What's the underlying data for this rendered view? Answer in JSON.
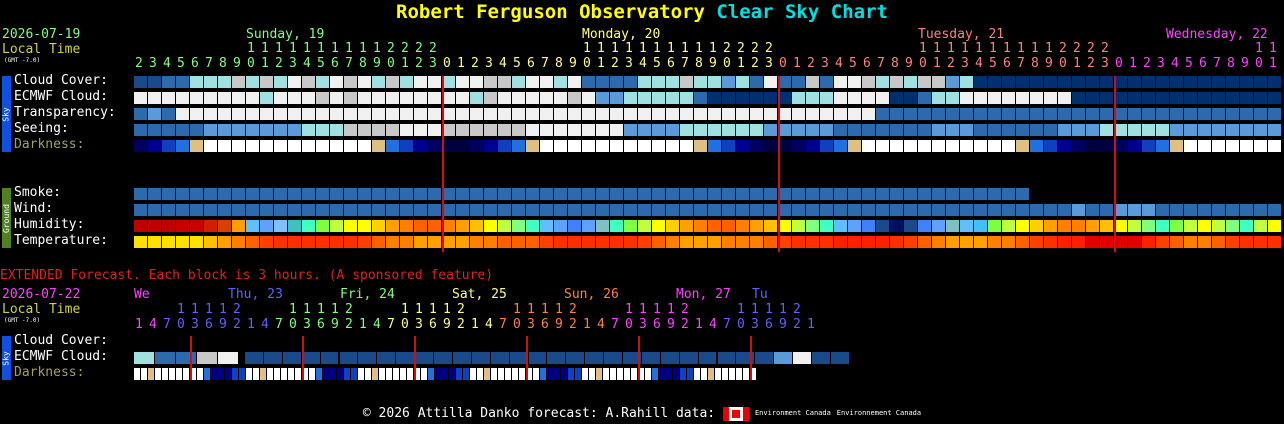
{
  "title": {
    "name": "Robert Ferguson Observatory",
    "suffix": "Clear Sky Chart"
  },
  "top": {
    "date": "2026-07-19",
    "local_time": "Local Time",
    "gmt": "(GMT -7.0)",
    "days": [
      {
        "label": "Sunday, 19",
        "color": "#80ff80"
      },
      {
        "label": "Monday, 20",
        "color": "#ffff80"
      },
      {
        "label": "Tuesday, 21",
        "color": "#ff8080"
      },
      {
        "label": "Wednesday, 22",
        "color": "#ff40ff"
      }
    ],
    "hours": [
      2,
      3,
      4,
      5,
      6,
      7,
      8,
      9,
      10,
      11,
      12,
      13,
      14,
      15,
      16,
      17,
      18,
      19,
      20,
      21,
      22,
      23,
      0,
      1,
      2,
      3,
      4,
      5,
      6,
      7,
      8,
      9,
      10,
      11,
      12,
      13,
      14,
      15,
      16,
      17,
      18,
      19,
      20,
      21,
      22,
      23,
      0,
      1,
      2,
      3,
      4,
      5,
      6,
      7,
      8,
      9,
      10,
      11,
      12,
      13,
      14,
      15,
      16,
      17,
      18,
      19,
      20,
      21,
      22,
      23,
      0,
      1,
      2,
      3,
      4,
      5,
      6,
      7,
      8,
      9,
      10,
      11
    ]
  },
  "rows": {
    "cloud": "Cloud Cover:",
    "ecmwf": "ECMWF Cloud:",
    "transp": "Transparency:",
    "seeing": "Seeing:",
    "dark": "Darkness:",
    "smoke": "Smoke:",
    "wind": "Wind:",
    "humidity": "Humidity:",
    "temp": "Temperature:"
  },
  "sidebar": {
    "sky": "Sky",
    "ground": "Ground"
  },
  "extended": {
    "note": "EXTENDED Forecast. Each block is 3 hours. (A sponsored feature)",
    "date": "2026-07-22",
    "local_time": "Local Time",
    "gmt": "(GMT -7.0)",
    "days": [
      {
        "label": "We",
        "color": "#ff40ff"
      },
      {
        "label": "Thu, 23",
        "color": "#6060ff"
      },
      {
        "label": "Fri, 24",
        "color": "#80ff80"
      },
      {
        "label": "Sat, 25",
        "color": "#ffff80"
      },
      {
        "label": "Sun, 26",
        "color": "#ff8040"
      },
      {
        "label": "Mon, 27",
        "color": "#ff40ff"
      },
      {
        "label": "Tu",
        "color": "#6060ff"
      }
    ],
    "hours": [
      1,
      4,
      7,
      10,
      13,
      16,
      19,
      22,
      1,
      4,
      7,
      10,
      13,
      16,
      19,
      22,
      1,
      4,
      7,
      10,
      13,
      16,
      19,
      22,
      1,
      4,
      7,
      10,
      13,
      16,
      19,
      22,
      1,
      4,
      7,
      10,
      13,
      16,
      19,
      22,
      1,
      4,
      7,
      10,
      13,
      16,
      19,
      22,
      1
    ],
    "rows": {
      "cloud": "Cloud Cover:",
      "ecmwf": "ECMWF Cloud:",
      "dark": "Darkness:"
    }
  },
  "footer": {
    "copyright": "© 2026 Attilla Danko  forecast: A.Rahill  data:",
    "ec1": "Environment Canada",
    "ec2": "Environnement Canada"
  },
  "colors": {
    "title_a": "#ffff00",
    "title_b": "#00e0e0",
    "label": "#ffffff",
    "darkness_label": "#a0a060",
    "date": "#80ff80",
    "local_time": "#d0d040",
    "extended_note": "#e02020",
    "divider": "#d01010"
  }
}
